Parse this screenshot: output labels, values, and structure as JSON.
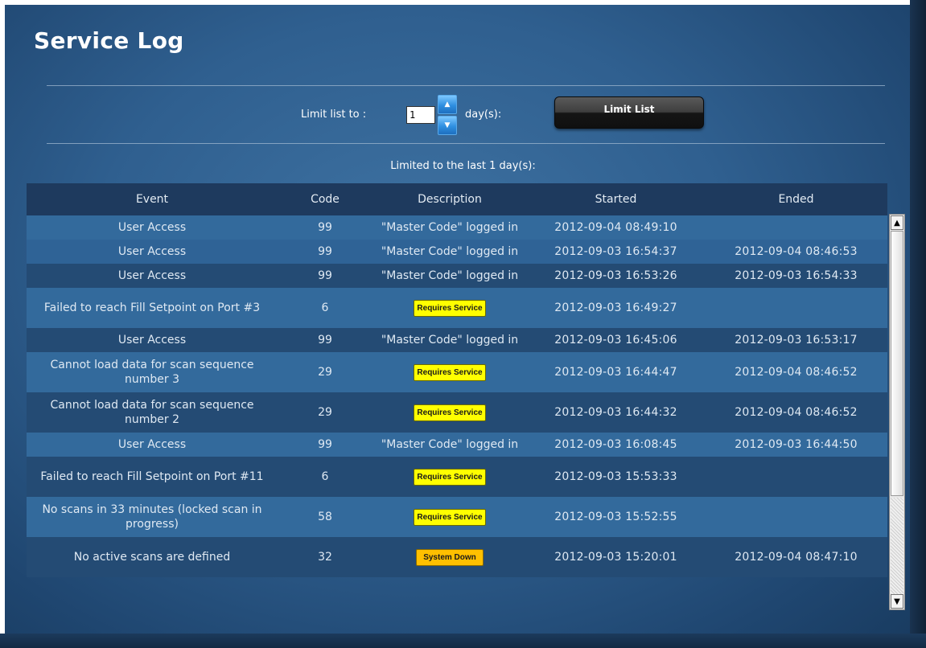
{
  "title": "Service Log",
  "limit": {
    "label": "Limit list to :",
    "value": "1",
    "unit_label": "day(s):",
    "button_label": "Limit List",
    "spin_up": "▲",
    "spin_down": "▼"
  },
  "limited_message": "Limited to the last 1 day(s):",
  "table": {
    "headers": {
      "event": "Event",
      "code": "Code",
      "description": "Description",
      "started": "Started",
      "ended": "Ended"
    },
    "rows": [
      {
        "event": "User Access",
        "code": "99",
        "description": "\"Master Code\" logged in",
        "started": "2012-09-04 08:49:10",
        "ended": ""
      },
      {
        "event": "User Access",
        "code": "99",
        "description": "\"Master Code\" logged in",
        "started": "2012-09-03 16:54:37",
        "ended": "2012-09-04 08:46:53"
      },
      {
        "event": "User Access",
        "code": "99",
        "description": "\"Master Code\" logged in",
        "started": "2012-09-03 16:53:26",
        "ended": "2012-09-03 16:54:33"
      },
      {
        "event": "Failed to reach Fill Setpoint on Port #3",
        "code": "6",
        "description": "Requires Service",
        "started": "2012-09-03 16:49:27",
        "ended": ""
      },
      {
        "event": "User Access",
        "code": "99",
        "description": "\"Master Code\" logged in",
        "started": "2012-09-03 16:45:06",
        "ended": "2012-09-03 16:53:17"
      },
      {
        "event": "Cannot load data for scan sequence number 3",
        "code": "29",
        "description": "Requires Service",
        "started": "2012-09-03 16:44:47",
        "ended": "2012-09-04 08:46:52"
      },
      {
        "event": "Cannot load data for scan sequence number 2",
        "code": "29",
        "description": "Requires Service",
        "started": "2012-09-03 16:44:32",
        "ended": "2012-09-04 08:46:52"
      },
      {
        "event": "User Access",
        "code": "99",
        "description": "\"Master Code\" logged in",
        "started": "2012-09-03 16:08:45",
        "ended": "2012-09-03 16:44:50"
      },
      {
        "event": "Failed to reach Fill Setpoint on Port #11",
        "code": "6",
        "description": "Requires Service",
        "started": "2012-09-03 15:53:33",
        "ended": ""
      },
      {
        "event": "No scans in 33 minutes (locked scan in progress)",
        "code": "58",
        "description": "Requires Service",
        "started": "2012-09-03 15:52:55",
        "ended": ""
      },
      {
        "event": "No active scans are defined",
        "code": "32",
        "description": "System Down",
        "started": "2012-09-03 15:20:01",
        "ended": "2012-09-04 08:47:10"
      }
    ]
  },
  "scrollbar": {
    "up_arrow": "▲",
    "down_arrow": "▼"
  },
  "colors": {
    "badge_requires_service": "#ffff00",
    "badge_system_down": "#ffc000",
    "row_dark": "#244b74",
    "row_light": "#336a9c",
    "header": "#1e3a5e"
  }
}
